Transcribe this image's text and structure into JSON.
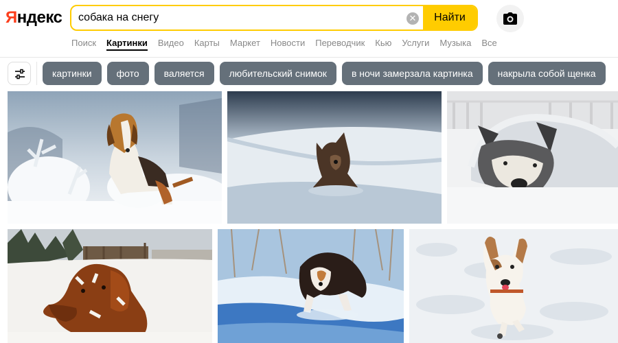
{
  "logo": {
    "first": "Я",
    "rest": "ндекс"
  },
  "search": {
    "query": "собака на снегу",
    "button_label": "Найти",
    "clear_icon": "close-icon"
  },
  "camera": {
    "icon": "camera-icon"
  },
  "nav": [
    {
      "label": "Поиск",
      "active": false
    },
    {
      "label": "Картинки",
      "active": true
    },
    {
      "label": "Видео",
      "active": false
    },
    {
      "label": "Карты",
      "active": false
    },
    {
      "label": "Маркет",
      "active": false
    },
    {
      "label": "Новости",
      "active": false
    },
    {
      "label": "Переводчик",
      "active": false
    },
    {
      "label": "Кью",
      "active": false
    },
    {
      "label": "Услуги",
      "active": false
    },
    {
      "label": "Музыка",
      "active": false
    },
    {
      "label": "Все",
      "active": false
    }
  ],
  "filters": {
    "icon": "sliders-icon"
  },
  "chips": [
    "картинки",
    "фото",
    "валяется",
    "любительский снимок",
    "в ночи замерзала картинка",
    "накрыла собой щенка"
  ],
  "results": [
    {
      "scene": "beagle-in-snowy-forest"
    },
    {
      "scene": "dark-dog-in-deep-snow"
    },
    {
      "scene": "husky-covered-in-snow"
    },
    {
      "scene": "red-setter-in-snow"
    },
    {
      "scene": "spaniel-running-in-snow"
    },
    {
      "scene": "terrier-running-in-snow"
    }
  ],
  "colors": {
    "accent": "#ffcc00",
    "logo_red": "#fc3f1d",
    "chip_bg": "#65707a"
  }
}
